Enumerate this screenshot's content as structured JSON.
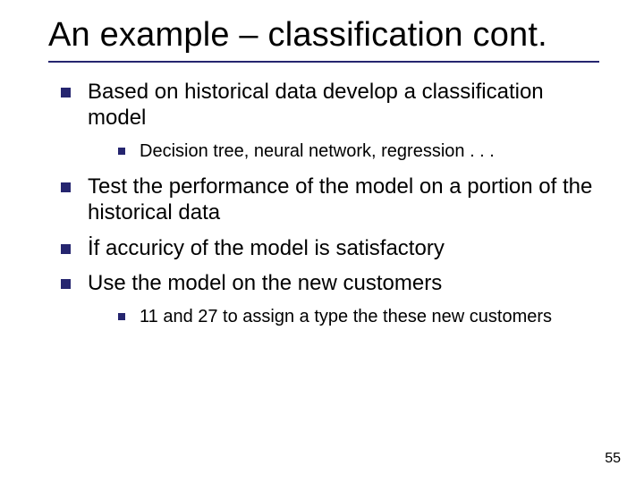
{
  "title": "An example – classification cont.",
  "bullets": {
    "b1": "Based on historical data develop a classification model",
    "b1_1": "Decision tree, neural network, regression . . .",
    "b2": "Test the performance of the model on a portion of the historical data",
    "b3": "İf accuricy of the model is satisfactory",
    "b4": "Use the model on the new customers",
    "b4_1": "11 and 27 to assign a type the these new customers"
  },
  "page_number": "55"
}
